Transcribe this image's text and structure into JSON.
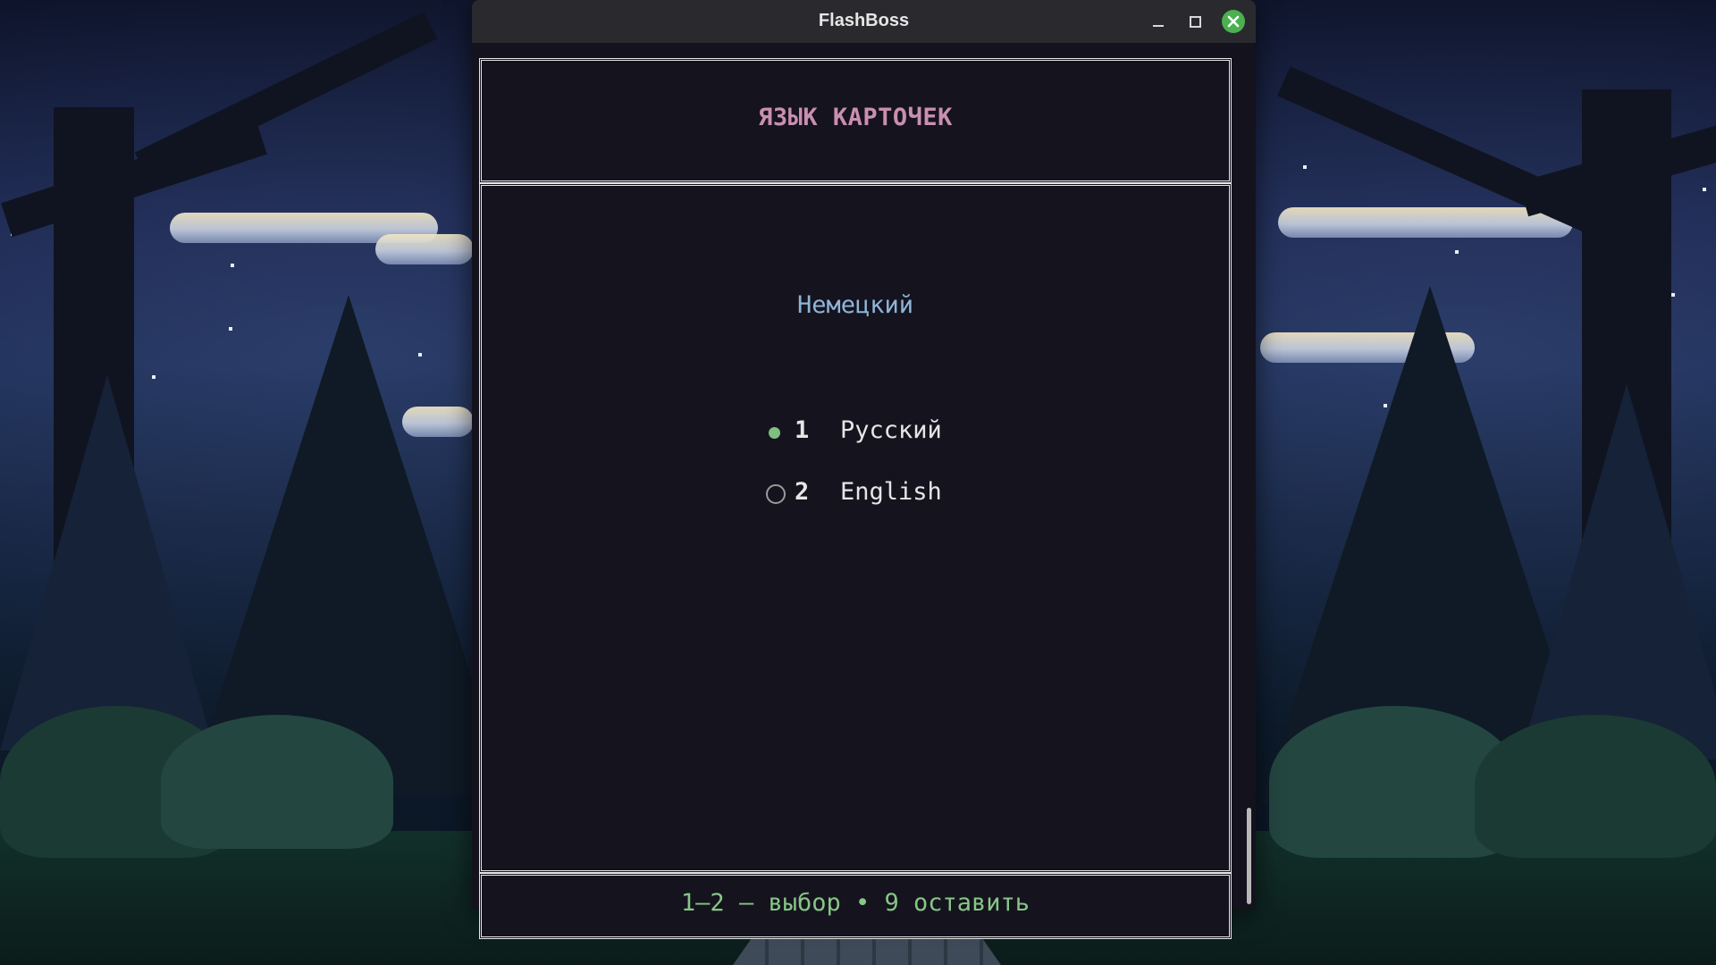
{
  "window": {
    "title": "FlashBoss"
  },
  "header": {
    "title": "ЯЗЫК КАРТОЧЕК"
  },
  "main": {
    "source_language": "Немецкий",
    "options": [
      {
        "key": "1",
        "label": "Русский",
        "selected": true
      },
      {
        "key": "2",
        "label": "English",
        "selected": false
      }
    ]
  },
  "footer": {
    "hint": "1–2 — выбор • 9 оставить"
  },
  "icons": {
    "minimize": "minimize-icon",
    "maximize": "maximize-icon",
    "close": "close-icon",
    "radio_selected": "radio-selected-icon",
    "radio_unselected": "radio-unselected-icon"
  },
  "colors": {
    "header_title": "#c98fb0",
    "source_language": "#8eb5d8",
    "footer_hint": "#86c686",
    "radio_selected": "#7fbf7f",
    "close_button": "#4caf50",
    "window_bg": "#14121d"
  }
}
